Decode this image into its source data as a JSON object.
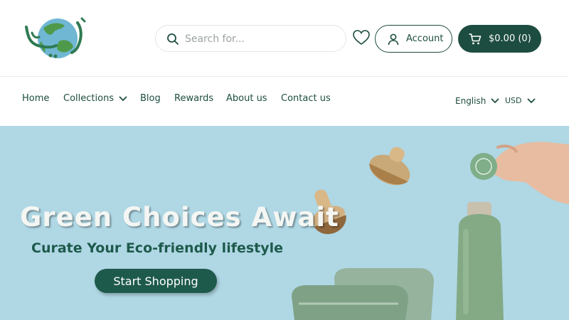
{
  "header": {
    "search": {
      "placeholder": "Search for..."
    },
    "account_label": "Account",
    "cart_label": "$0.00 (0)"
  },
  "nav": {
    "items": [
      {
        "label": "Home"
      },
      {
        "label": "Collections"
      },
      {
        "label": "Blog"
      },
      {
        "label": "Rewards"
      },
      {
        "label": "About us"
      },
      {
        "label": "Contact us"
      }
    ],
    "language": "English",
    "currency": "USD"
  },
  "hero": {
    "title": "Green Choices Await",
    "subtitle": "Curate Your Eco-friendly lifestyle",
    "cta_label": "Start Shopping"
  },
  "colors": {
    "primary": "#1d4d40",
    "hero_bg": "#afd7e4",
    "hero_text": "#f4f6f3"
  },
  "icons": [
    "logo-globe",
    "search-icon",
    "heart-icon",
    "user-icon",
    "cart-icon",
    "chevron-down-icon"
  ]
}
